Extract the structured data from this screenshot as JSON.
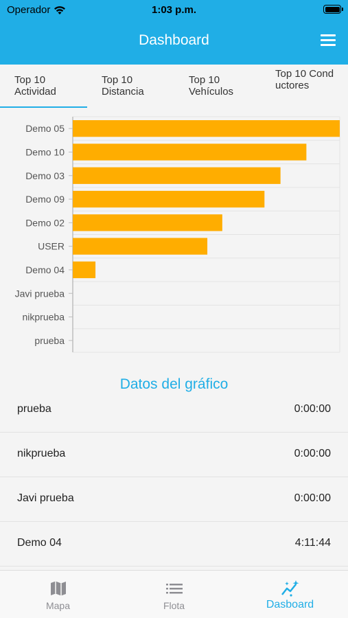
{
  "status_bar": {
    "carrier": "Operador",
    "time": "1:03 p.m."
  },
  "nav": {
    "title": "Dashboard",
    "menu_icon": "hamburger-menu-icon"
  },
  "tabs": [
    {
      "label": "Top 10 Actividad",
      "active": true
    },
    {
      "label": "Top 10 Distancia",
      "active": false
    },
    {
      "label": "Top 10 Vehículos",
      "active": false
    },
    {
      "label": "Top 10 Conductores",
      "active": false
    }
  ],
  "chart_data": {
    "type": "bar",
    "orientation": "horizontal",
    "categories": [
      "Demo 05",
      "Demo 10",
      "Demo 03",
      "Demo 09",
      "Demo 02",
      "USER",
      "Demo 04",
      "Javi prueba",
      "nikprueba",
      "prueba"
    ],
    "values": [
      1.0,
      0.875,
      0.778,
      0.718,
      0.56,
      0.504,
      0.085,
      0,
      0,
      0
    ],
    "value_unit": "fraction of maximum",
    "bar_color": "#ffad00",
    "grid": true
  },
  "data_section": {
    "title": "Datos del gráfico",
    "rows": [
      {
        "name": "prueba",
        "value": "0:00:00"
      },
      {
        "name": "nikprueba",
        "value": "0:00:00"
      },
      {
        "name": "Javi prueba",
        "value": "0:00:00"
      },
      {
        "name": "Demo 04",
        "value": "4:11:44"
      }
    ]
  },
  "tabbar": {
    "items": [
      {
        "label": "Mapa",
        "icon": "map-icon",
        "active": false
      },
      {
        "label": "Flota",
        "icon": "list-icon",
        "active": false
      },
      {
        "label": "Dasboard",
        "icon": "chart-sparkle-icon",
        "active": true
      }
    ]
  },
  "colors": {
    "accent": "#20aee6",
    "bar": "#ffad00",
    "inactive": "#8e8e93"
  }
}
